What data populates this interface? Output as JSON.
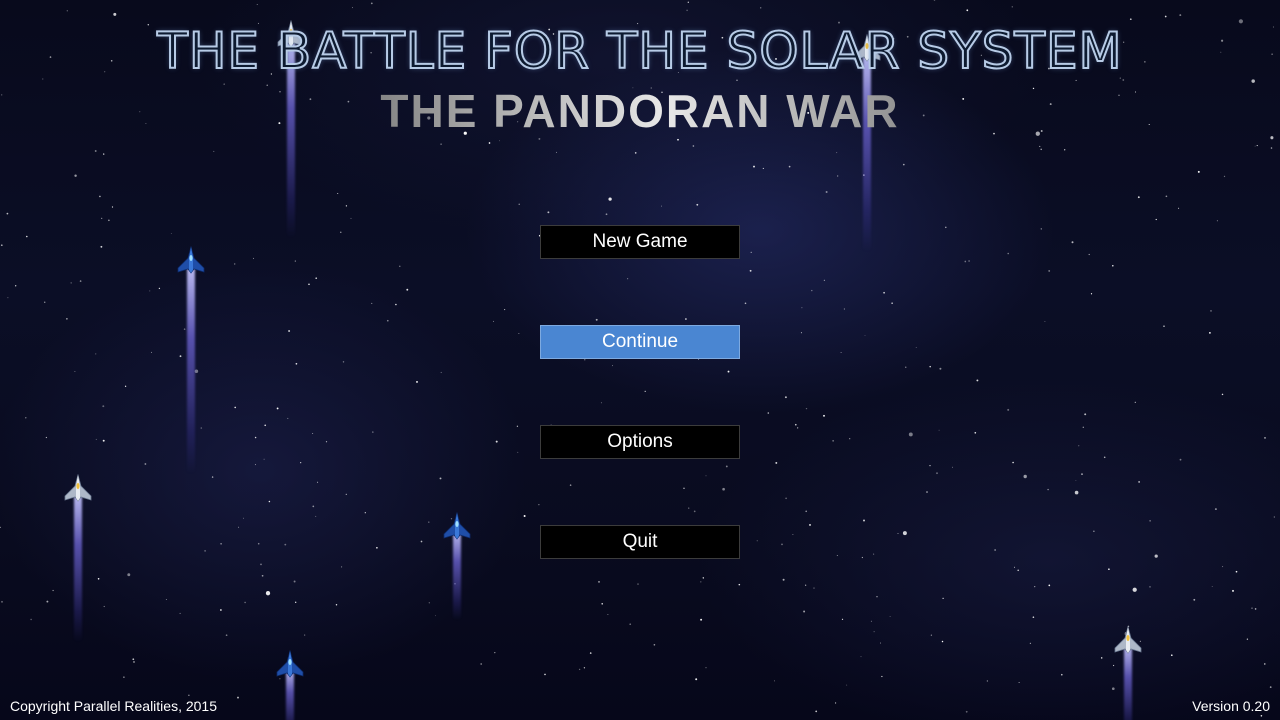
{
  "title": {
    "main": "THE BATTLE FOR THE SOLAR SYSTEM",
    "subtitle": "THE PANDORAN WAR"
  },
  "menu": {
    "items": [
      {
        "label": "New Game",
        "selected": false
      },
      {
        "label": "Continue",
        "selected": true
      },
      {
        "label": "Options",
        "selected": false
      },
      {
        "label": "Quit",
        "selected": false
      }
    ]
  },
  "footer": {
    "copyright": "Copyright Parallel Realities, 2015",
    "version": "Version 0.20"
  },
  "colors": {
    "selected_button": "#4a86d2",
    "button_background": "#000000",
    "engine_trail": "#7a70e6",
    "space_background": "#0a0d22"
  },
  "background": {
    "ships": [
      {
        "icon": "fighter-ship-icon",
        "variant": "white"
      },
      {
        "icon": "fighter-ship-icon",
        "variant": "blue"
      },
      {
        "icon": "fighter-ship-icon",
        "variant": "white"
      },
      {
        "icon": "fighter-ship-icon",
        "variant": "blue"
      },
      {
        "icon": "fighter-ship-icon",
        "variant": "blue"
      },
      {
        "icon": "fighter-ship-icon",
        "variant": "white"
      },
      {
        "icon": "fighter-ship-icon",
        "variant": "white"
      }
    ]
  }
}
